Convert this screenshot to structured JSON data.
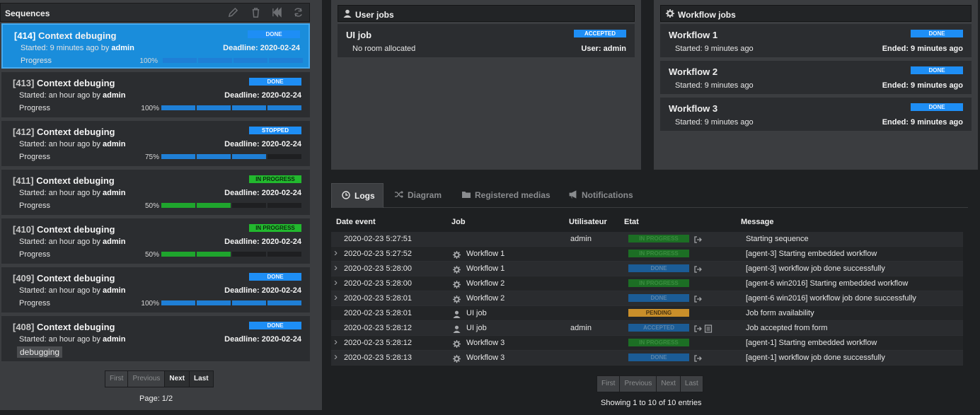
{
  "sequences": {
    "title": "Sequences",
    "items": [
      {
        "id": "[414]",
        "name": "Context debuging",
        "status": "DONE",
        "started_prefix": "Started: 9 minutes ago by ",
        "user": "admin",
        "deadline": "Deadline: 2020-02-24",
        "progress_label": "Progress",
        "progress_pct": "100%",
        "progress": 1.0,
        "color": "blue"
      },
      {
        "id": "[413]",
        "name": "Context debuging",
        "status": "DONE",
        "started_prefix": "Started: an hour ago by ",
        "user": "admin",
        "deadline": "Deadline: 2020-02-24",
        "progress_label": "Progress",
        "progress_pct": "100%",
        "progress": 1.0,
        "color": "blue"
      },
      {
        "id": "[412]",
        "name": "Context debuging",
        "status": "STOPPED",
        "started_prefix": "Started: an hour ago by ",
        "user": "admin",
        "deadline": "Deadline: 2020-02-24",
        "progress_label": "Progress",
        "progress_pct": "75%",
        "progress": 0.75,
        "color": "blue"
      },
      {
        "id": "[411]",
        "name": "Context debuging",
        "status": "IN PROGRESS",
        "started_prefix": "Started: an hour ago by ",
        "user": "admin",
        "deadline": "Deadline: 2020-02-24",
        "progress_label": "Progress",
        "progress_pct": "50%",
        "progress": 0.5,
        "color": "green"
      },
      {
        "id": "[410]",
        "name": "Context debuging",
        "status": "IN PROGRESS",
        "started_prefix": "Started: an hour ago by ",
        "user": "admin",
        "deadline": "Deadline: 2020-02-24",
        "progress_label": "Progress",
        "progress_pct": "50%",
        "progress": 0.5,
        "color": "green"
      },
      {
        "id": "[409]",
        "name": "Context debuging",
        "status": "DONE",
        "started_prefix": "Started: an hour ago by ",
        "user": "admin",
        "deadline": "Deadline: 2020-02-24",
        "progress_label": "Progress",
        "progress_pct": "100%",
        "progress": 1.0,
        "color": "blue"
      },
      {
        "id": "[408]",
        "name": "Context debuging",
        "status": "DONE",
        "started_prefix": "Started: an hour ago by ",
        "user": "admin",
        "deadline": "Deadline: 2020-02-24",
        "tag": "debugging"
      }
    ],
    "pager": {
      "first": "First",
      "previous": "Previous",
      "next": "Next",
      "last": "Last"
    },
    "page": "Page: 1/2"
  },
  "user_jobs": {
    "title": "User jobs",
    "items": [
      {
        "name": "UI job",
        "status": "ACCEPTED",
        "sub": "No room allocated",
        "right": "User: admin"
      }
    ]
  },
  "workflow_jobs": {
    "title": "Workflow jobs",
    "items": [
      {
        "name": "Workflow 1",
        "status": "DONE",
        "sub": "Started: 9 minutes ago",
        "right": "Ended: 9 minutes ago"
      },
      {
        "name": "Workflow 2",
        "status": "DONE",
        "sub": "Started: 9 minutes ago",
        "right": "Ended: 9 minutes ago"
      },
      {
        "name": "Workflow 3",
        "status": "DONE",
        "sub": "Started: 9 minutes ago",
        "right": "Ended: 9 minutes ago"
      }
    ]
  },
  "tabs": [
    {
      "label": "Logs",
      "icon": "clock-icon",
      "active": true
    },
    {
      "label": "Diagram",
      "icon": "shuffle-icon",
      "active": false
    },
    {
      "label": "Registered medias",
      "icon": "folder-icon",
      "active": false
    },
    {
      "label": "Notifications",
      "icon": "megaphone-icon",
      "active": false
    }
  ],
  "logs": {
    "headers": {
      "date": "Date event",
      "job": "Job",
      "user": "Utilisateur",
      "state": "Etat",
      "message": "Message"
    },
    "rows": [
      {
        "expand": false,
        "date": "2020-02-23 5:27:51",
        "job_icon": "",
        "job": "",
        "user": "admin",
        "state": "IN PROGRESS",
        "state_kind": "progress",
        "icons": [
          "sign-out-icon"
        ],
        "message": "Starting sequence"
      },
      {
        "expand": true,
        "date": "2020-02-23 5:27:52",
        "job_icon": "gear-icon",
        "job": "Workflow 1",
        "user": "",
        "state": "IN PROGRESS",
        "state_kind": "progress",
        "icons": [],
        "message": "[agent-3] Starting embedded workflow"
      },
      {
        "expand": true,
        "date": "2020-02-23 5:28:00",
        "job_icon": "gear-icon",
        "job": "Workflow 1",
        "user": "",
        "state": "DONE",
        "state_kind": "done",
        "icons": [
          "sign-out-icon"
        ],
        "message": "[agent-3] workflow job done successfully"
      },
      {
        "expand": true,
        "date": "2020-02-23 5:28:00",
        "job_icon": "gear-icon",
        "job": "Workflow 2",
        "user": "",
        "state": "IN PROGRESS",
        "state_kind": "progress",
        "icons": [],
        "message": "[agent-6 win2016] Starting embedded workflow"
      },
      {
        "expand": true,
        "date": "2020-02-23 5:28:01",
        "job_icon": "gear-icon",
        "job": "Workflow 2",
        "user": "",
        "state": "DONE",
        "state_kind": "done",
        "icons": [
          "sign-out-icon"
        ],
        "message": "[agent-6 win2016] workflow job done successfully"
      },
      {
        "expand": false,
        "date": "2020-02-23 5:28:01",
        "job_icon": "user-icon",
        "job": "UI job",
        "user": "",
        "state": "PENDING",
        "state_kind": "pending",
        "icons": [],
        "message": "Job form availability"
      },
      {
        "expand": false,
        "date": "2020-02-23 5:28:12",
        "job_icon": "user-icon",
        "job": "UI job",
        "user": "admin",
        "state": "ACCEPTED",
        "state_kind": "accepted",
        "icons": [
          "sign-out-icon",
          "list-icon"
        ],
        "message": "Job accepted from form"
      },
      {
        "expand": true,
        "date": "2020-02-23 5:28:12",
        "job_icon": "gear-icon",
        "job": "Workflow 3",
        "user": "",
        "state": "IN PROGRESS",
        "state_kind": "progress",
        "icons": [],
        "message": "[agent-1] Starting embedded workflow"
      },
      {
        "expand": true,
        "date": "2020-02-23 5:28:13",
        "job_icon": "gear-icon",
        "job": "Workflow 3",
        "user": "",
        "state": "DONE",
        "state_kind": "done",
        "icons": [
          "sign-out-icon"
        ],
        "message": "[agent-1] workflow job done successfully"
      }
    ],
    "pager": {
      "first": "First",
      "previous": "Previous",
      "next": "Next",
      "last": "Last"
    },
    "entries": "Showing 1 to 10 of 10 entries"
  },
  "colors": {
    "accent": "#1a8ddb",
    "done": "#1e8ef5",
    "progress": "#22b92e",
    "pending": "#c98f2a",
    "panel": "#3b3d40",
    "card": "#2b2d30"
  }
}
